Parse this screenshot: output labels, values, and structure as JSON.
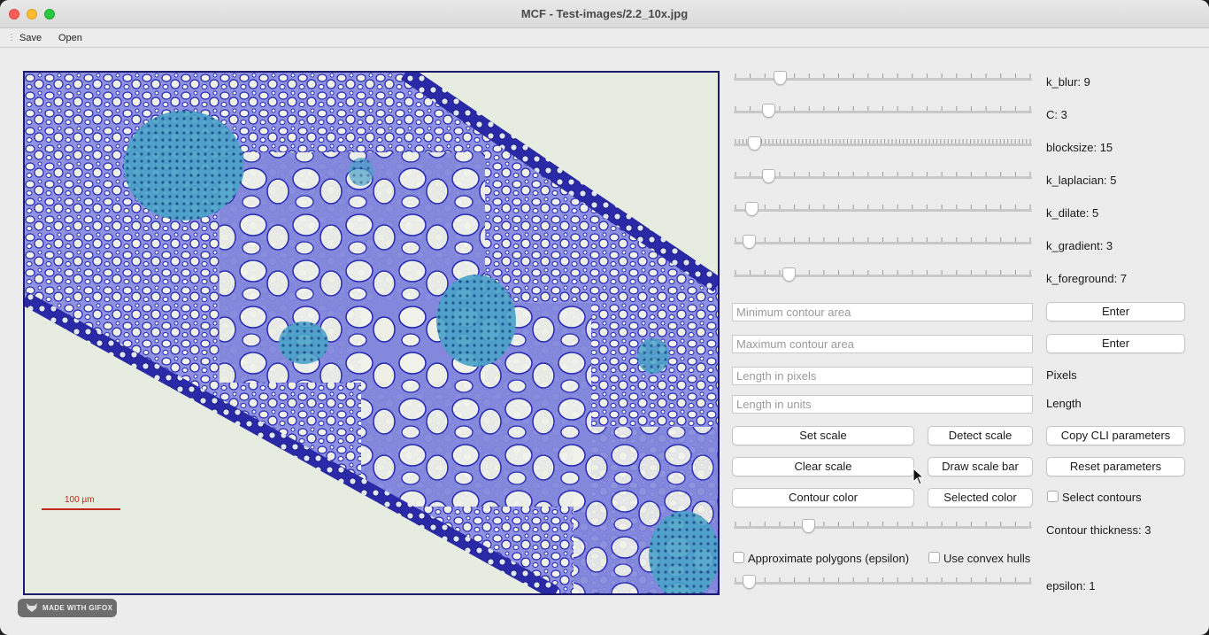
{
  "window": {
    "title": "MCF - Test-images/2.2_10x.jpg"
  },
  "toolbar": {
    "save_label": "Save",
    "open_label": "Open"
  },
  "image": {
    "scalebar_label": "100 µm"
  },
  "sliders": [
    {
      "label": "k_blur: 9",
      "value": 9,
      "fraction": 0.14
    },
    {
      "label": "C: 3",
      "value": 3,
      "fraction": 0.1
    },
    {
      "label": "blocksize: 15",
      "value": 15,
      "fraction": 0.05
    },
    {
      "label": "k_laplacian: 5",
      "value": 5,
      "fraction": 0.1
    },
    {
      "label": "k_dilate: 5",
      "value": 5,
      "fraction": 0.04
    },
    {
      "label": "k_gradient: 3",
      "value": 3,
      "fraction": 0.03
    },
    {
      "label": "k_foreground: 7",
      "value": 7,
      "fraction": 0.17
    }
  ],
  "fields": {
    "min_contour_placeholder": "Minimum contour area",
    "max_contour_placeholder": "Maximum contour area",
    "length_pixels_placeholder": "Length in pixels",
    "length_units_placeholder": "Length in units"
  },
  "buttons": {
    "enter_min": "Enter",
    "enter_max": "Enter",
    "set_scale": "Set scale",
    "detect_scale": "Detect scale",
    "copy_cli": "Copy CLI parameters",
    "clear_scale": "Clear scale",
    "draw_scale_bar": "Draw scale bar",
    "reset_parameters": "Reset parameters",
    "contour_color": "Contour color",
    "selected_color": "Selected color"
  },
  "labels": {
    "pixels": "Pixels",
    "length": "Length",
    "select_contours": "Select contours",
    "contour_thickness": "Contour thickness: 3",
    "approximate_polygons": "Approximate polygons (epsilon)",
    "use_convex_hulls": "Use convex hulls",
    "epsilon": "epsilon: 1"
  },
  "contour_thickness": {
    "value": 3,
    "fraction": 0.24
  },
  "epsilon": {
    "value": 1,
    "fraction": 0.03
  },
  "checkboxes": {
    "select_contours": false,
    "approximate_polygons": false,
    "use_convex_hulls": false
  },
  "watermark": "MADE WITH GIFOX",
  "colors": {
    "tissue": "#7b7fd6",
    "contour": "#2424b0",
    "vascular": "#4aa3c9",
    "scalebar": "#c0281e"
  }
}
